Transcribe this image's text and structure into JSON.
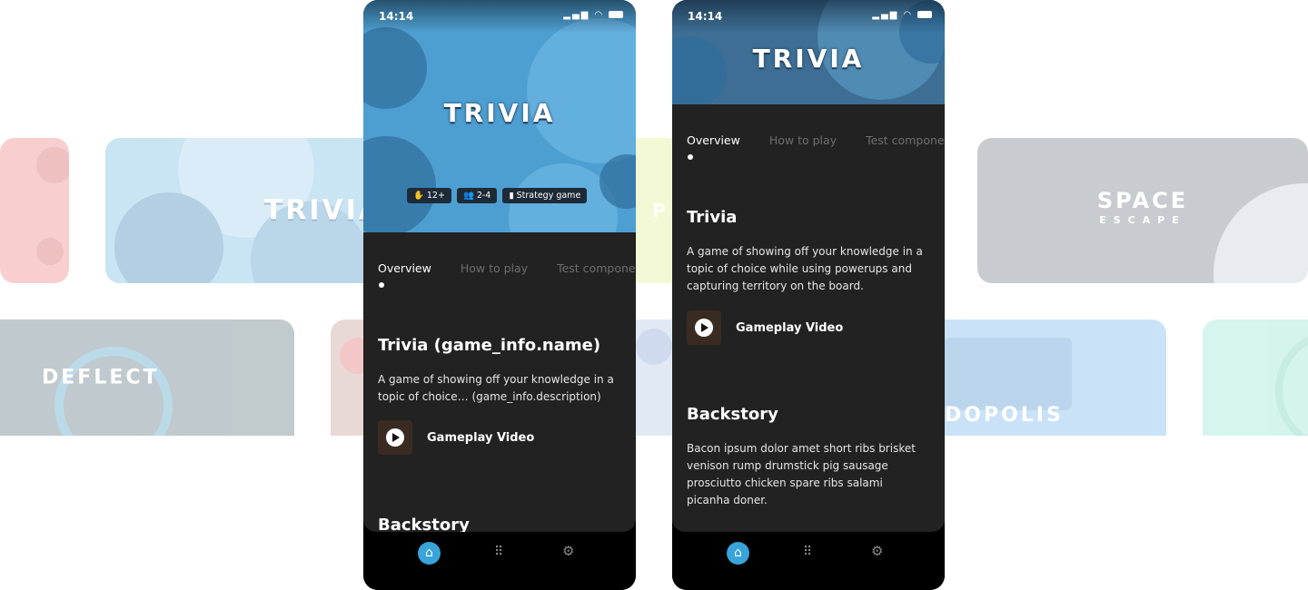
{
  "background_cards": {
    "trivia_logo": "TRIVIA",
    "space_logo_main": "SPACE",
    "space_logo_sub": "ESCAPE",
    "deflect_logo": "DEFLECT",
    "topolis_logo": "DOPOLIS",
    "partial_letter": "P"
  },
  "phone1": {
    "status_time": "14:14",
    "hero_title": "TRIVIA",
    "badges": [
      {
        "icon": "age-icon",
        "label": "12+"
      },
      {
        "icon": "players-icon",
        "label": "2-4"
      },
      {
        "icon": "genre-icon",
        "label": "Strategy game"
      }
    ],
    "tabs": [
      "Overview",
      "How to play",
      "Test component"
    ],
    "game_name": "Trivia (game_info.name)",
    "game_description": "A game of showing off your knowledge in a topic of choice… (game_info.description)",
    "video_label": "Gameplay Video",
    "backstory_title": "Backstory"
  },
  "phone2": {
    "status_time": "14:14",
    "hero_title": "TRIVIA",
    "tabs": [
      "Overview",
      "How to play",
      "Test component"
    ],
    "game_name": "Trivia",
    "game_description": "A game of showing off your knowledge in a topic of choice while using powerups and capturing territory on the board.",
    "video_label": "Gameplay Video",
    "backstory_title": "Backstory",
    "backstory_text": "Bacon ipsum dolor amet short ribs brisket venison rump drumstick pig sausage prosciutto chicken spare ribs salami picanha doner."
  },
  "nav": {
    "items": [
      "home-icon",
      "grid-icon",
      "gear-icon"
    ]
  },
  "colors": {
    "accent": "#38a4da",
    "panel": "#222222",
    "hero": "#4e9fd1"
  }
}
